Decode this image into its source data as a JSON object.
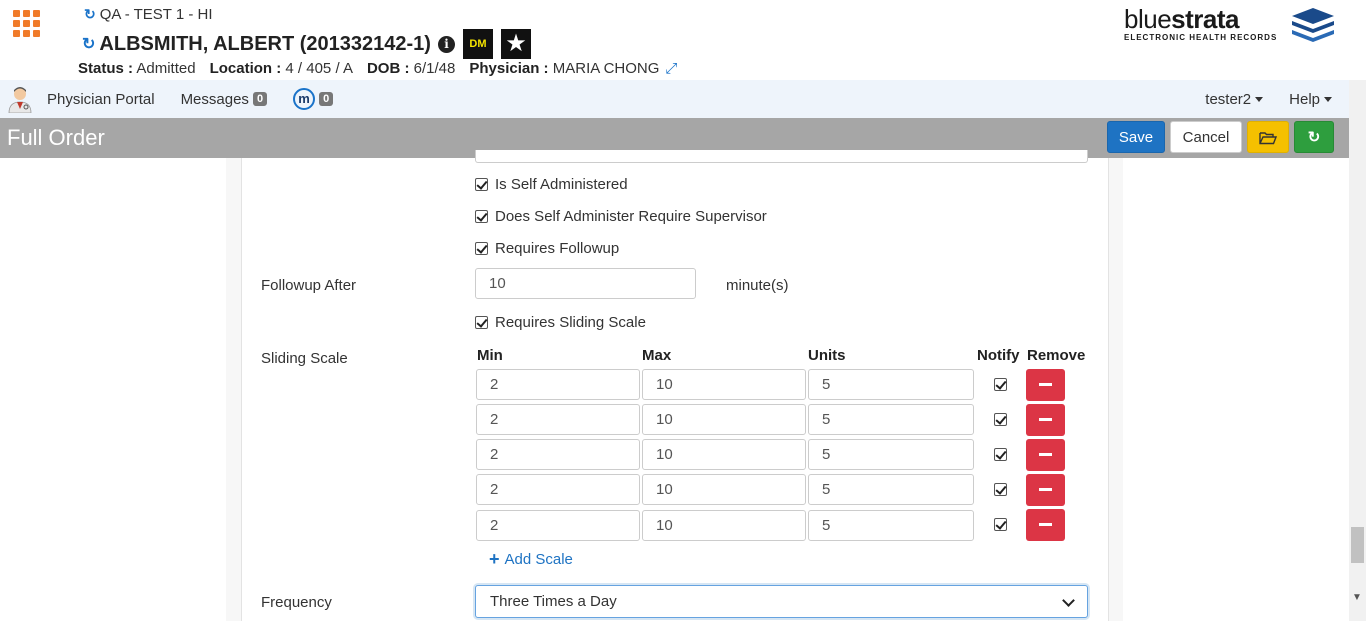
{
  "header": {
    "facility": "QA - TEST 1 - HI",
    "patient_name": "ALBSMITH, ALBERT (201332142-1)",
    "badge_dm": "DM",
    "status_label": "Status :",
    "status_value": "Admitted",
    "location_label": "Location :",
    "location_value": "4 / 405 / A",
    "dob_label": "DOB :",
    "dob_value": "6/1/48",
    "physician_label": "Physician :",
    "physician_value": "MARIA CHONG"
  },
  "logo": {
    "name_light": "blue",
    "name_bold": "strata",
    "tagline": "ELECTRONIC HEALTH RECORDS"
  },
  "nav": {
    "physician_portal": "Physician Portal",
    "messages": "Messages",
    "messages_count": "0",
    "m_count": "0",
    "m_letter": "m",
    "user": "tester2",
    "help": "Help"
  },
  "titlebar": {
    "title": "Full Order",
    "save": "Save",
    "cancel": "Cancel"
  },
  "form": {
    "is_self_administered": "Is Self Administered",
    "self_admin_supervisor": "Does Self Administer Require Supervisor",
    "requires_followup": "Requires Followup",
    "followup_after_label": "Followup After",
    "followup_after_value": "10",
    "followup_unit": "minute(s)",
    "requires_sliding_scale": "Requires Sliding Scale",
    "sliding_scale_label": "Sliding Scale",
    "columns": {
      "min": "Min",
      "max": "Max",
      "units": "Units",
      "notify": "Notify",
      "remove": "Remove"
    },
    "rows": [
      {
        "min": "2",
        "max": "10",
        "units": "5",
        "notify": true
      },
      {
        "min": "2",
        "max": "10",
        "units": "5",
        "notify": true
      },
      {
        "min": "2",
        "max": "10",
        "units": "5",
        "notify": true
      },
      {
        "min": "2",
        "max": "10",
        "units": "5",
        "notify": true
      },
      {
        "min": "2",
        "max": "10",
        "units": "5",
        "notify": true
      }
    ],
    "add_scale": "Add Scale",
    "frequency_label": "Frequency",
    "frequency_value": "Three Times a Day"
  },
  "colors": {
    "primary": "#1e73c3",
    "danger": "#dc3545",
    "warning": "#f5c000",
    "success": "#2e9e3e",
    "titlebar": "#a6a6a6",
    "apps_icon": "#f07b2a"
  }
}
